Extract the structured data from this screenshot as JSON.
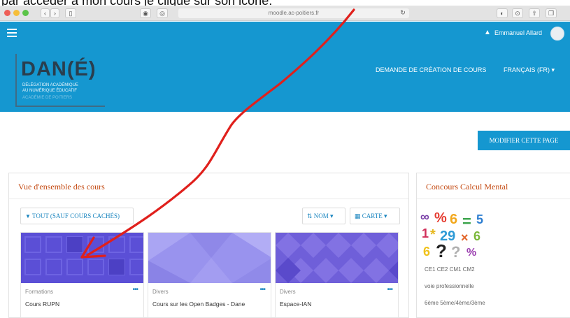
{
  "caption": "par accéder à mon cours je clique sur son icône.",
  "browser": {
    "url": "moodle.ac-poitiers.fr"
  },
  "navbar": {
    "username": "Emmanuel Allard",
    "color": "#1597d0"
  },
  "logo": {
    "title": "DAN(É)",
    "line1": "DÉLÉGATION ACADÉMIQUE",
    "line2": "AU NUMÉRIQUE ÉDUCATIF",
    "line3": "ACADÉMIE DE POITIERS"
  },
  "header": {
    "link_request": "DEMANDE DE CRÉATION DE COURS",
    "language": "FRANÇAIS (FR) ▾"
  },
  "page": {
    "edit_button": "MODIFIER CETTE PAGE"
  },
  "overview": {
    "title": "Vue d'ensemble des cours",
    "filter": "TOUT (SAUF COURS CACHÉS)",
    "sort": "NOM ▾",
    "view": "CARTE ▾",
    "courses": [
      {
        "category": "Formations",
        "name": "Cours RUPN",
        "menu": "•••"
      },
      {
        "category": "Divers",
        "name": "Cours sur les Open Badges - Dane",
        "menu": "•••"
      },
      {
        "category": "Divers",
        "name": "Espace-IAN",
        "menu": "•••"
      }
    ]
  },
  "mental": {
    "title": "Concours Calcul Mental",
    "line1": "CE1  CE2  CM1  CM2",
    "line2": "voie professionnelle",
    "line3": "6ème   5ème/4ème/3ème"
  },
  "annotation_color": "#e0201c"
}
